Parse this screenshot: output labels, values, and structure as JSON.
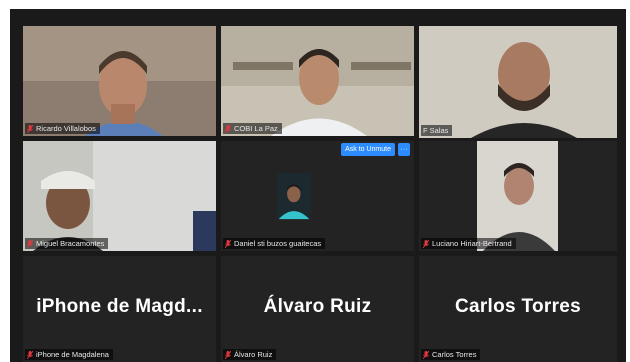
{
  "meeting": {
    "participants": [
      {
        "name": "Ricardo Villalobos",
        "muted": true,
        "display": "video"
      },
      {
        "name": "COBI La Paz",
        "muted": true,
        "display": "video"
      },
      {
        "name": "F Salas",
        "muted": false,
        "display": "video",
        "active_speaker": true
      },
      {
        "name": "Miguel Bracamontes",
        "muted": true,
        "display": "video"
      },
      {
        "name": "Daniel sti buzos guaitecas",
        "muted": true,
        "display": "video"
      },
      {
        "name": "Luciano Hiriart-Bertrand",
        "muted": true,
        "display": "video"
      },
      {
        "name": "iPhone de Magdalena",
        "muted": true,
        "display": "name",
        "big_label": "iPhone de Magd..."
      },
      {
        "name": "Álvaro Ruiz",
        "muted": true,
        "display": "name",
        "big_label": "Álvaro Ruiz"
      },
      {
        "name": "Carlos Torres",
        "muted": true,
        "display": "name",
        "big_label": "Carlos Torres"
      }
    ],
    "hover_controls": {
      "ask_to_unmute_label": "Ask to Unmute",
      "more_label": "···"
    }
  },
  "colors": {
    "active_speaker_border": "#d6e46a",
    "muted_icon": "#e0383e",
    "button_blue": "#2d8cff"
  }
}
